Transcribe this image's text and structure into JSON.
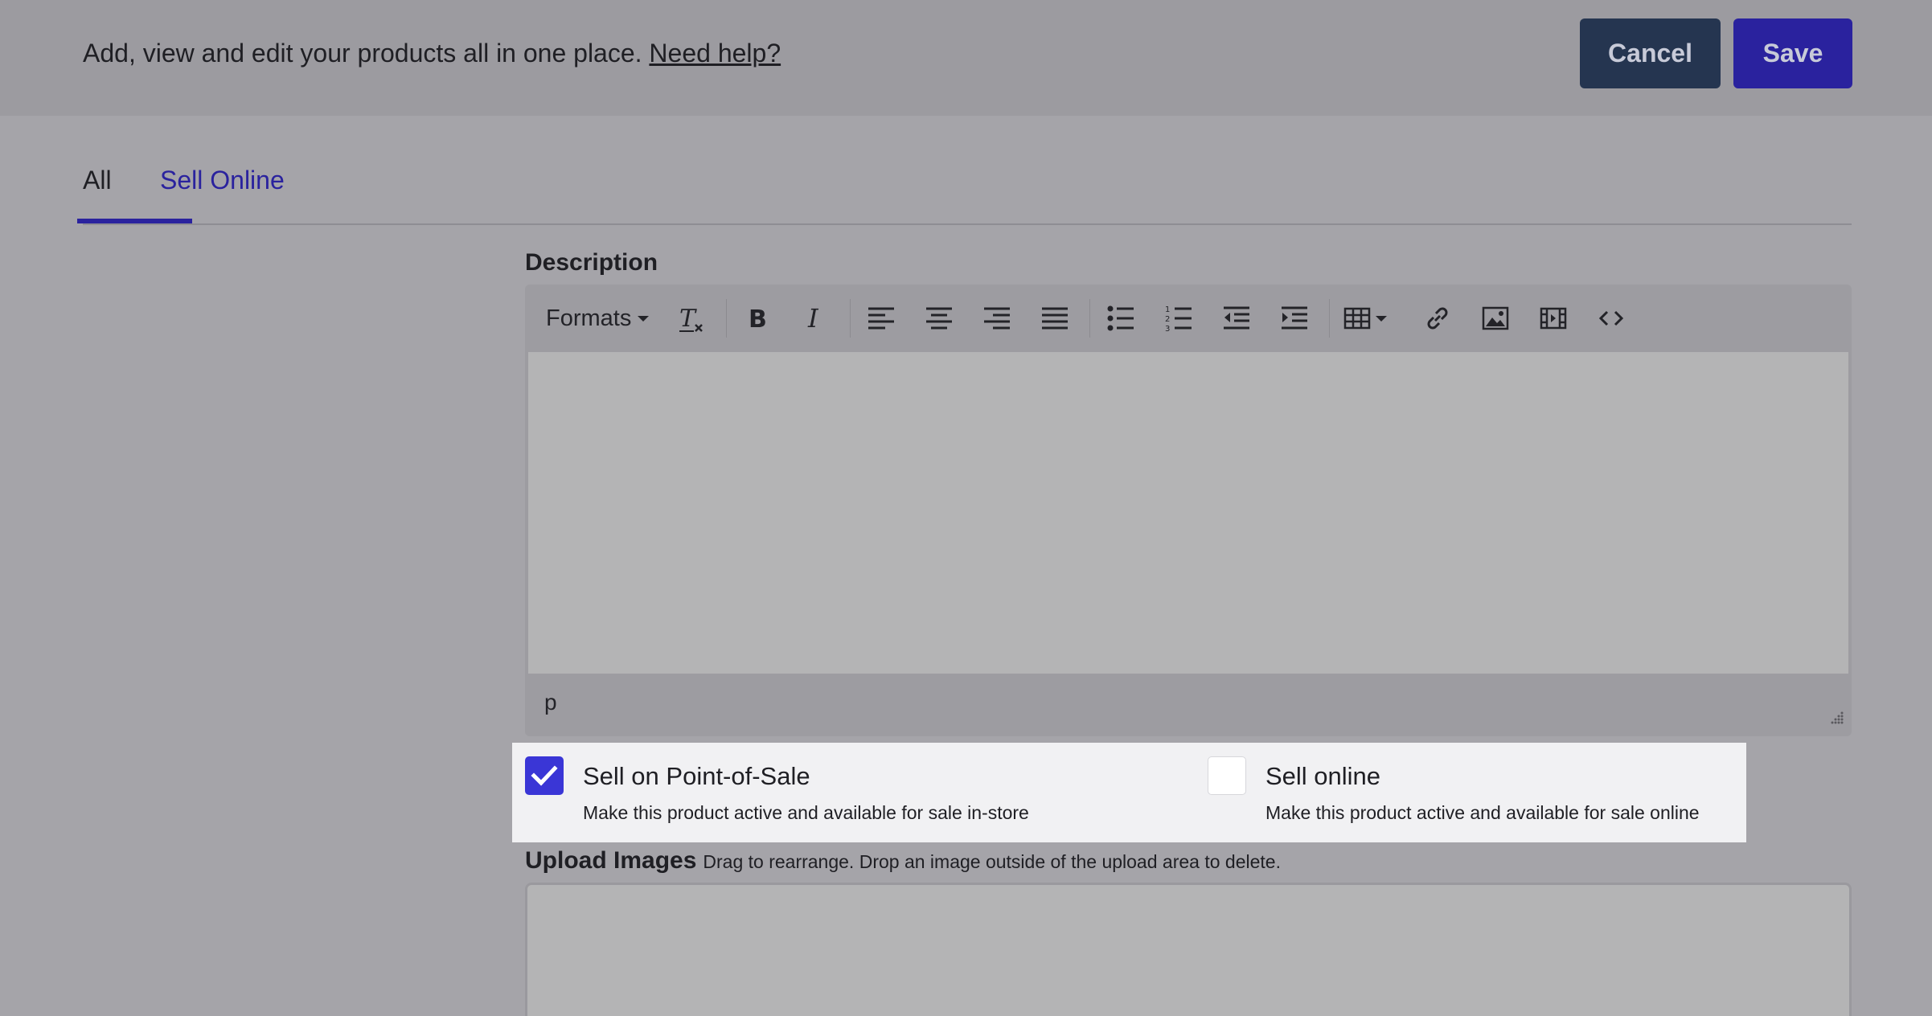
{
  "header": {
    "intro_text": "Add, view and edit your products all in one place.",
    "help_link": "Need help?",
    "cancel_label": "Cancel",
    "save_label": "Save"
  },
  "tabs": [
    {
      "label": "All",
      "active": false
    },
    {
      "label": "Sell Online",
      "active": true
    }
  ],
  "description": {
    "label": "Description",
    "toolbar": {
      "formats_label": "Formats",
      "buttons": [
        "clear-formatting-icon",
        "bold-icon",
        "italic-icon",
        "align-left-icon",
        "align-center-icon",
        "align-right-icon",
        "align-justify-icon",
        "bullet-list-icon",
        "numbered-list-icon",
        "outdent-icon",
        "indent-icon",
        "table-icon",
        "link-icon",
        "image-icon",
        "media-icon",
        "source-code-icon"
      ]
    },
    "path": "p"
  },
  "sell_options": [
    {
      "title": "Sell on Point-of-Sale",
      "description": "Make this product active and available for sale in-store",
      "checked": true
    },
    {
      "title": "Sell online",
      "description": "Make this product active and available for sale online",
      "checked": false
    }
  ],
  "upload": {
    "label": "Upload Images",
    "hint": "Drag to rearrange. Drop an image outside of the upload area to delete."
  },
  "colors": {
    "accent": "#2a229e",
    "checkbox_checked": "#3a36d6",
    "cancel_bg": "#253550",
    "overlay_bg": "#a5a4a9"
  }
}
